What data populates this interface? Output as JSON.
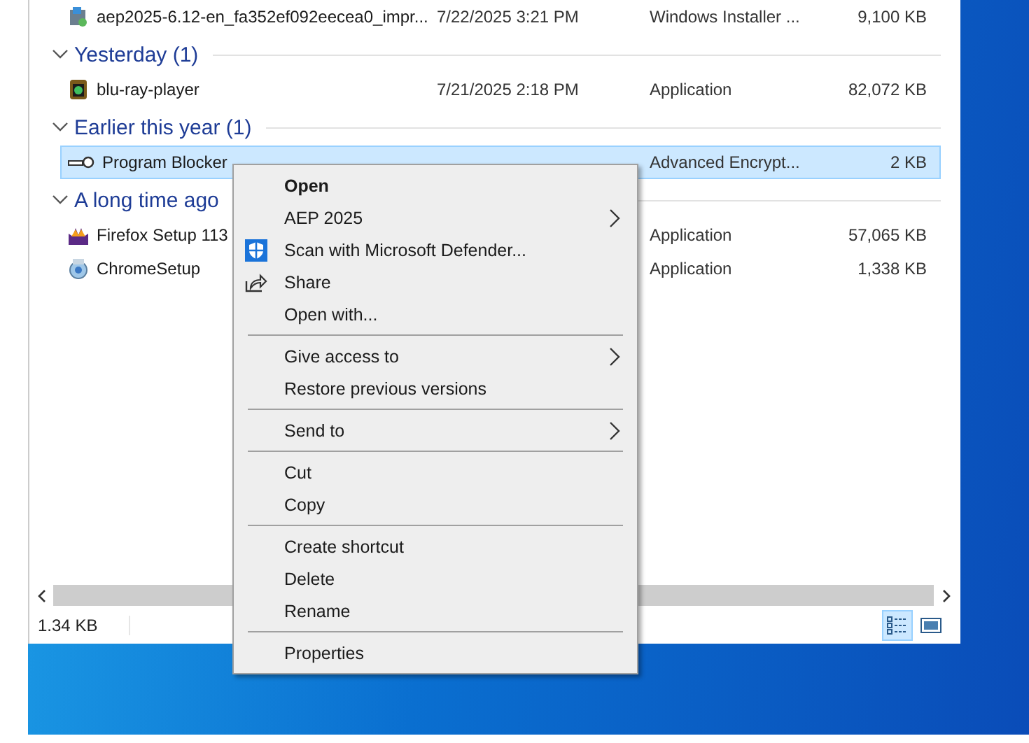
{
  "file_list": {
    "groups": [
      {
        "items": [
          {
            "kind": "installer",
            "name": "aep2025-6.12-en_fa352ef092eecea0_impr...",
            "date": "7/22/2025 3:21 PM",
            "type": "Windows Installer ...",
            "size": "9,100 KB",
            "selected": false
          }
        ]
      },
      {
        "header": "Yesterday (1)",
        "expanded": true,
        "items": [
          {
            "kind": "player",
            "name": "blu-ray-player",
            "date": "7/21/2025 2:18 PM",
            "type": "Application",
            "size": "82,072 KB",
            "selected": false
          }
        ]
      },
      {
        "header": "Earlier this year (1)",
        "expanded": true,
        "items": [
          {
            "kind": "key",
            "name": "Program Blocker",
            "type": "Advanced Encrypt...",
            "size": "2 KB",
            "selected": true
          }
        ]
      },
      {
        "header": "A long time ago",
        "expanded": true,
        "items": [
          {
            "kind": "browser",
            "name": "Firefox Setup 113",
            "type": "Application",
            "size": "57,065 KB",
            "selected": false
          },
          {
            "kind": "setup",
            "name": "ChromeSetup",
            "type": "Application",
            "size": "1,338 KB",
            "selected": false
          }
        ]
      }
    ]
  },
  "status_bar": {
    "text": "1.34 KB",
    "views": [
      {
        "kind": "details",
        "selected": true
      },
      {
        "kind": "preview",
        "selected": false
      }
    ]
  },
  "context_menu": {
    "items": [
      {
        "kind": "default",
        "label": "Open"
      },
      {
        "kind": "submenu",
        "label": "AEP 2025"
      },
      {
        "kind": "scan",
        "label": "Scan with Microsoft Defender..."
      },
      {
        "kind": "share",
        "label": "Share"
      },
      {
        "kind": "command",
        "label": "Open with..."
      },
      {
        "kind": "separator"
      },
      {
        "kind": "submenu",
        "label": "Give access to"
      },
      {
        "kind": "command",
        "label": "Restore previous versions"
      },
      {
        "kind": "separator"
      },
      {
        "kind": "submenu",
        "label": "Send to"
      },
      {
        "kind": "separator"
      },
      {
        "kind": "command",
        "label": "Cut"
      },
      {
        "kind": "command",
        "label": "Copy"
      },
      {
        "kind": "separator"
      },
      {
        "kind": "command",
        "label": "Create shortcut"
      },
      {
        "kind": "command",
        "label": "Delete"
      },
      {
        "kind": "command",
        "label": "Rename"
      },
      {
        "kind": "separator"
      },
      {
        "kind": "command",
        "label": "Properties"
      }
    ]
  }
}
